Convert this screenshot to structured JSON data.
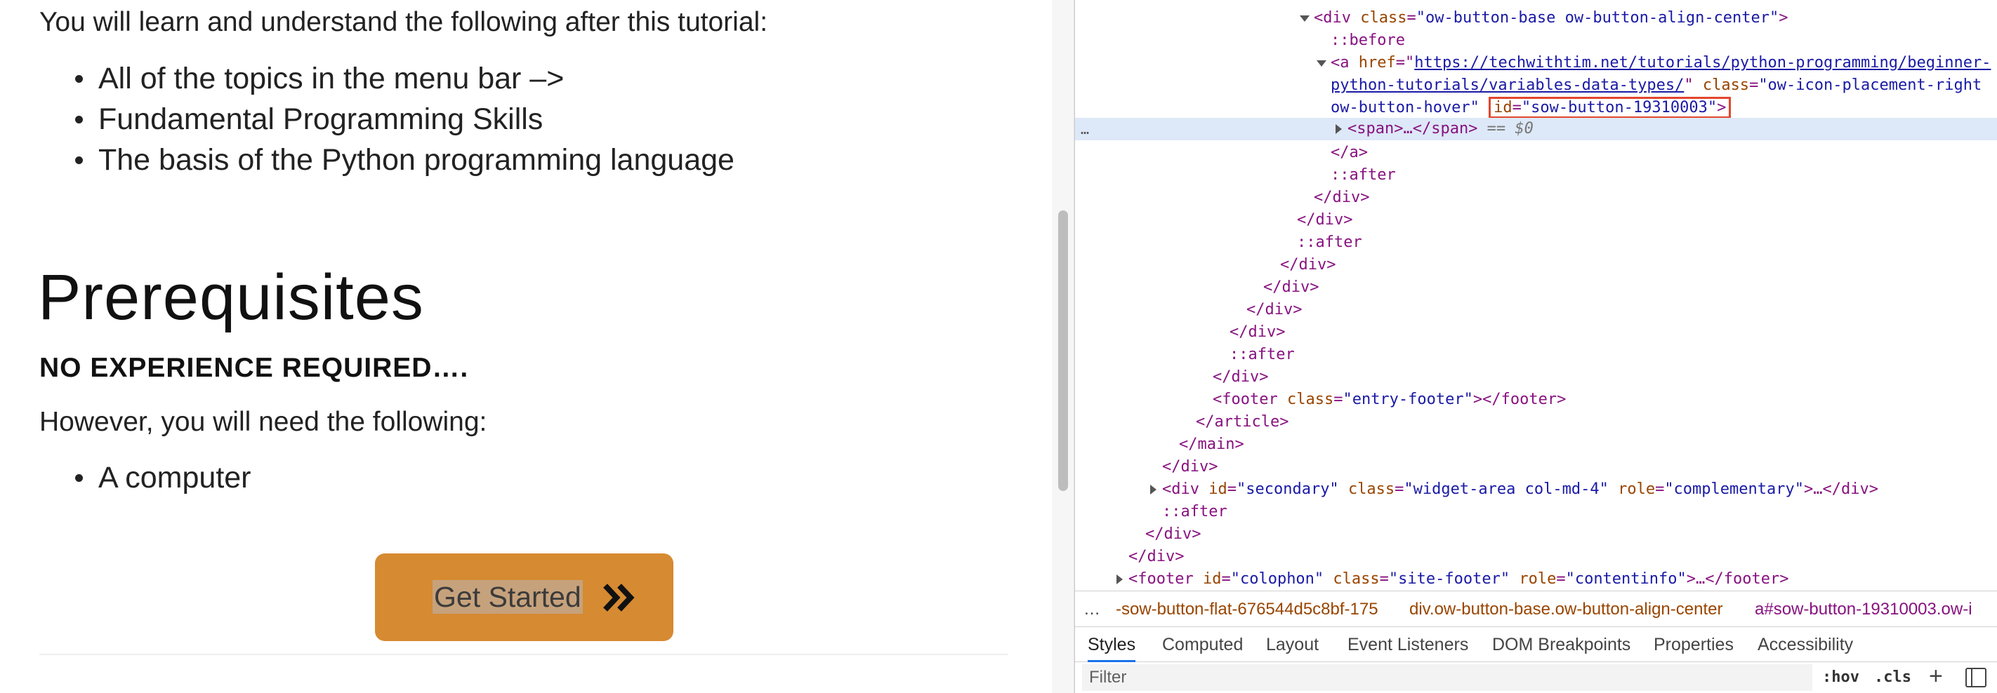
{
  "page": {
    "intro": "You will learn and understand the following after this tutorial:",
    "learn_items": [
      "All of the topics in the menu bar –>",
      "Fundamental Programming Skills",
      "The basis of the Python programming language"
    ],
    "prereq_heading": "Prerequisites",
    "no_experience": "NO EXPERIENCE REQUIRED….",
    "however": "However, you will need the following:",
    "need_items": [
      "A computer"
    ],
    "cta_label": "Get Started",
    "cta_icon": "double-chevron-right-icon",
    "cta_color": "#d68a32"
  },
  "devtools": {
    "dom": {
      "l1_tag": "<div ",
      "l1_attr1": "class",
      "l1_val1": "\"ow-button-base ow-button-align-center\"",
      "l1_end": ">",
      "l2": "::before",
      "l3_tag": "<a ",
      "l3_attr1": "href",
      "l3_link1": "https://techwithtim.net/tutorials/python-programming/beginner-",
      "l4_link2": "python-tutorials/variables-data-types/",
      "l4_q": "\" ",
      "l4_attr2": "class",
      "l4_val2": "\"ow-icon-placement-right",
      "l5_val2b": "ow-button-hover\"",
      "l5_attr3": "id",
      "l5_val3": "\"sow-button-19310003\"",
      "l5_end": ">",
      "l6_tag": "<span>…</span>",
      "l6_eq": " == $0",
      "l7": "</a>",
      "l8": "::after",
      "l9": "</div>",
      "l10": "</div>",
      "l11": "::after",
      "l12": "</div>",
      "l13": "</div>",
      "l14": "</div>",
      "l15": "</div>",
      "l16": "::after",
      "l17": "</div>",
      "l18_tag": "<footer ",
      "l18_attr": "class",
      "l18_val": "\"entry-footer\"",
      "l18_end": "></footer>",
      "l19": "</article>",
      "l20": "</main>",
      "l21": "</div>",
      "l22_tag": "<div ",
      "l22_a1": "id",
      "l22_v1": "\"secondary\"",
      "l22_a2": "class",
      "l22_v2": "\"widget-area col-md-4\"",
      "l22_a3": "role",
      "l22_v3": "\"complementary\"",
      "l22_end": ">…</div>",
      "l23": "::after",
      "l24": "</div>",
      "l25": "</div>",
      "l26_tag": "<footer ",
      "l26_a1": "id",
      "l26_v1": "\"colophon\"",
      "l26_a2": "class",
      "l26_v2": "\"site-footer\"",
      "l26_a3": "role",
      "l26_v3": "\"contentinfo\"",
      "l26_end": ">…</footer>",
      "ellipsis": "…"
    },
    "breadcrumb": {
      "ellipsis": "…",
      "item1": "-sow-button-flat-676544d5c8bf-175",
      "item2": "div.ow-button-base.ow-button-align-center",
      "item3": "a#sow-button-19310003.ow-i"
    },
    "tabs": [
      "Styles",
      "Computed",
      "Layout",
      "Event Listeners",
      "DOM Breakpoints",
      "Properties",
      "Accessibility"
    ],
    "active_tab": "Styles",
    "filter_placeholder": "Filter",
    "hov_label": ":hov",
    "cls_label": ".cls",
    "plus_label": "+",
    "highlight_color": "#e3462c",
    "selection_color": "#dde8f8"
  }
}
